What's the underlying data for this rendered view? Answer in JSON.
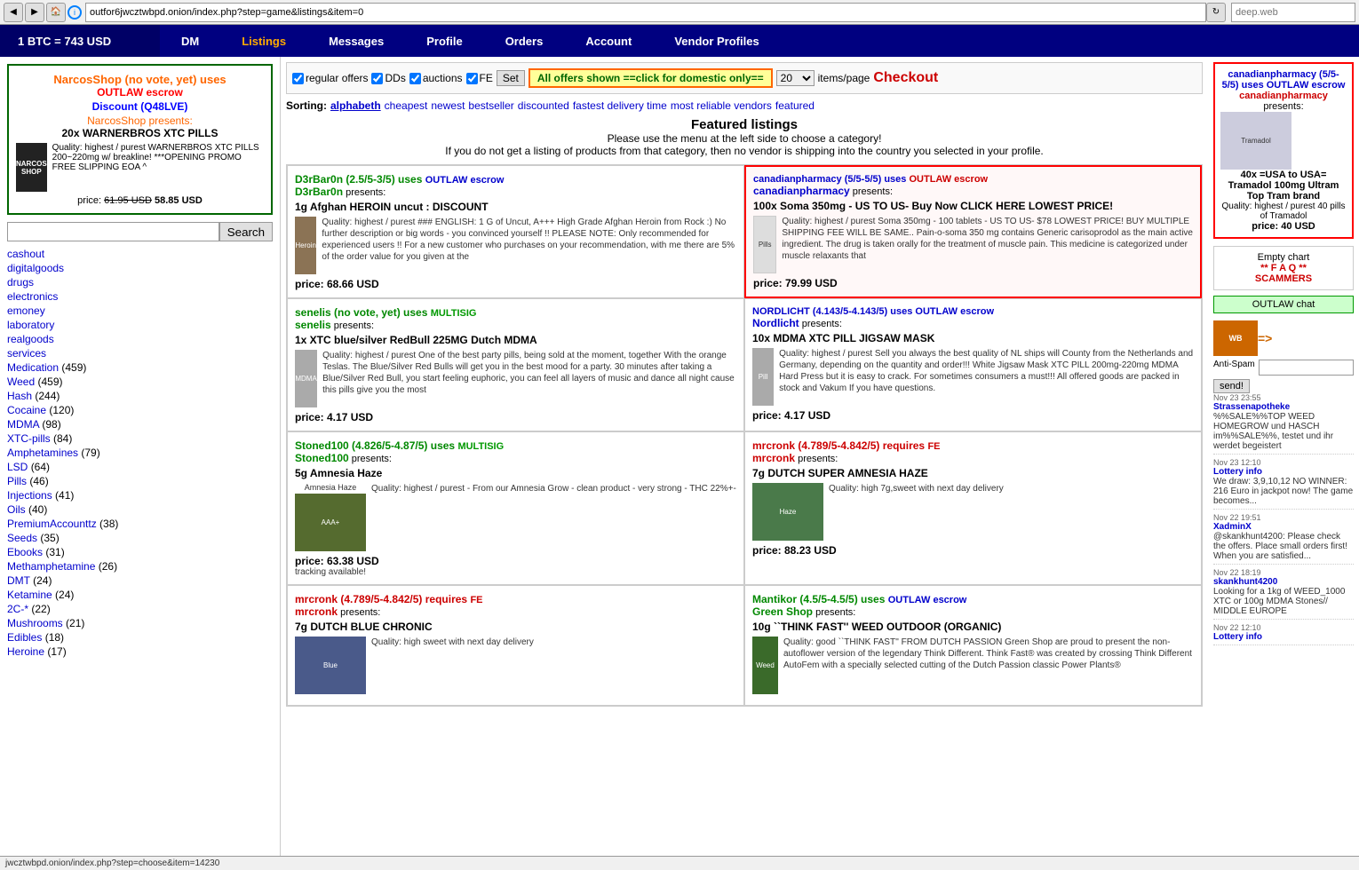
{
  "browser": {
    "url": "outfor6jwcztwbpd.onion/index.php?step=game&listings&item=0",
    "search_placeholder": "deep.web"
  },
  "nav": {
    "btc_rate": "1 BTC = 743 USD",
    "items": [
      {
        "label": "DM",
        "active": false
      },
      {
        "label": "Listings",
        "active": true
      },
      {
        "label": "Messages",
        "active": false
      },
      {
        "label": "Profile",
        "active": false
      },
      {
        "label": "Orders",
        "active": false
      },
      {
        "label": "Account",
        "active": false
      },
      {
        "label": "Vendor Profiles",
        "active": false
      }
    ]
  },
  "filters": {
    "regular_offers": "regular offers",
    "dds": "DDs",
    "auctions": "auctions",
    "fe": "FE",
    "set_btn": "Set",
    "domestic_btn": "All offers shown ==click for domestic only==",
    "items_per_page": "20",
    "checkout": "Checkout"
  },
  "sort": {
    "label": "Sorting:",
    "options": [
      "alphabeth",
      "cheapest",
      "newest",
      "bestseller",
      "discounted",
      "fastest delivery time",
      "most reliable vendors",
      "featured"
    ]
  },
  "featured_header": {
    "title": "Featured listings",
    "subtitle1": "Please use the menu at the left side to choose a category!",
    "subtitle2": "If you do not get a listing of products from that category, then no vendor is shipping into the country you selected in your profile."
  },
  "sidebar": {
    "featured_shop": {
      "name": "NarcosShop (no vote, yet) uses",
      "escrow": "OUTLAW escrow",
      "discount": "Discount (Q48LVE)",
      "presents": "NarcosShop presents:",
      "product": "20x WARNERBROS XTC PILLS",
      "quality": "Quality: highest / purest WARNERBROS XTC PILLS 200~220mg w/ breakline! ***OPENING PROMO FREE SLIPPING EOA ^",
      "price_old": "61.95 USD",
      "price_new": "58.85 USD"
    },
    "search_placeholder": "Search",
    "links": [
      {
        "label": "cashout",
        "count": ""
      },
      {
        "label": "digitalgoods",
        "count": ""
      },
      {
        "label": "drugs",
        "count": ""
      },
      {
        "label": "electronics",
        "count": ""
      },
      {
        "label": "emoney",
        "count": ""
      },
      {
        "label": "laboratory",
        "count": ""
      },
      {
        "label": "realgoods",
        "count": ""
      },
      {
        "label": "services",
        "count": ""
      },
      {
        "label": "Medication",
        "count": "(459)"
      },
      {
        "label": "Weed",
        "count": "(459)"
      },
      {
        "label": "Hash",
        "count": "(244)"
      },
      {
        "label": "Cocaine",
        "count": "(120)"
      },
      {
        "label": "MDMA",
        "count": "(98)"
      },
      {
        "label": "XTC-pills",
        "count": "(84)"
      },
      {
        "label": "Amphetamines",
        "count": "(79)"
      },
      {
        "label": "LSD",
        "count": "(64)"
      },
      {
        "label": "Pills",
        "count": "(46)"
      },
      {
        "label": "Injections",
        "count": "(41)"
      },
      {
        "label": "Oils",
        "count": "(40)"
      },
      {
        "label": "PremiumAccounttz",
        "count": "(38)"
      },
      {
        "label": "Seeds",
        "count": "(35)"
      },
      {
        "label": "Ebooks",
        "count": "(31)"
      },
      {
        "label": "Methamphetamine",
        "count": "(26)"
      },
      {
        "label": "DMT",
        "count": "(24)"
      },
      {
        "label": "Ketamine",
        "count": "(24)"
      },
      {
        "label": "2C-*",
        "count": "(22)"
      },
      {
        "label": "Mushrooms",
        "count": "(21)"
      },
      {
        "label": "Edibles",
        "count": "(18)"
      },
      {
        "label": "Heroine",
        "count": "(17)"
      }
    ]
  },
  "listings": [
    {
      "id": 1,
      "vendor_rating": "D3rBar0n (2.5/5-3/5) uses OUTLAW escrow",
      "vendor_name": "D3rBar0n",
      "vendor_color": "green",
      "escrow_type": "OUTLAW escrow",
      "badge": "escrow",
      "presents": "D3rBar0n presents:",
      "quantity": "1g",
      "product": "Afghan HEROIN uncut : DISCOUNT",
      "quality": "Quality: highest / purest ### ENGLISH: 1 G of Uncut, A+++ High Grade Afghan Heroin from Rock :) No further description or big words - you convinced yourself !! PLEASE NOTE: Only recommended for experienced users !! For a new customer who purchases on your recommendation, with me there are 5% of the order value for you given at the",
      "price": "68.66 USD",
      "highlighted": false,
      "img": "heroin"
    },
    {
      "id": 2,
      "vendor_rating": "canadianpharmacy (5/5-5/5) uses OUTLAW escrow",
      "vendor_name": "canadianpharmacy",
      "vendor_color": "blue",
      "escrow_type": "OUTLAW escrow",
      "badge": "escrow",
      "presents": "canadianpharmacy presents:",
      "quantity": "100x",
      "product": "Soma 350mg - US TO US- Buy Now CLICK HERE LOWEST PRICE!",
      "quality": "Quality: highest / purest Soma 350mg - 100 tablets - US TO US- $78 LOWEST PRICE! BUY MULTIPLE SHIPPING FEE WILL BE SAME.. Pain-o-soma 350 mg contains Generic carisoprodol as the main active ingredient. The drug is taken orally for the treatment of muscle pain. This medicine is categorized under muscle relaxants that",
      "price": "79.99 USD",
      "highlighted": true,
      "img": "soma"
    },
    {
      "id": 3,
      "vendor_rating": "senelis (no vote, yet) uses MULTISIG",
      "vendor_name": "senelis",
      "vendor_color": "green",
      "escrow_type": "MULTISIG",
      "badge": "multisig",
      "presents": "senelis presents:",
      "quantity": "1x",
      "product": "XTC blue/silver RedBull 225MG Dutch MDMA",
      "quality": "Quality: highest / purest One of the best party pills, being sold at the moment, together With the orange Teslas. The Blue/Silver Red Bulls will get you in the best mood for a party. 30 minutes after taking a Blue/Silver Red Bull, you start feeling euphoric, you can feel all layers of music and dance all night cause this pills give you the most",
      "price": "4.17 USD",
      "highlighted": false,
      "img": "mdma"
    },
    {
      "id": 4,
      "vendor_rating": "NORDLICHT (4.143/5-4.143/5) uses OUTLAW escrow",
      "vendor_name": "Nordlicht",
      "vendor_color": "blue",
      "escrow_type": "OUTLAW escrow",
      "badge": "escrow",
      "presents": "Nordlicht presents:",
      "quantity": "10x",
      "product": "MDMA XTC PILL JIGSAW MASK",
      "quality": "Quality: highest / purest Sell you always the best quality of NL ships will County from the Netherlands and Germany, depending on the quantity and order!!! White Jigsaw Mask XTC PILL 200mg-220mg MDMA Hard Press but it is easy to crack. For sometimes consumers a must!!! All offered goods are packed in stock and Vakum If you have questions.",
      "price": "price: 4.17 USD",
      "highlighted": false,
      "img": "mdma"
    },
    {
      "id": 5,
      "vendor_rating": "Stoned100 (4.826/5-4.87/5) uses MULTISIG",
      "vendor_name": "Stoned100",
      "vendor_color": "green",
      "escrow_type": "MULTISIG",
      "badge": "multisig",
      "presents": "Stoned100 presents:",
      "quantity": "5g",
      "product": "Amnesia Haze",
      "quality": "Quality: highest / purest - From our Amnesia Grow - clean product - very strong - THC 22%+-",
      "price": "63.38 USD",
      "tracking": "tracking available!",
      "highlighted": false,
      "img": "amnesia"
    },
    {
      "id": 6,
      "vendor_rating": "mrcronk (4.789/5-4.842/5) requires FE",
      "vendor_name": "mrcronk",
      "vendor_color": "red",
      "escrow_type": "FE",
      "badge": "fe",
      "presents": "mrcronk presents:",
      "quantity": "7g",
      "product": "DUTCH SUPER AMNESIA HAZE",
      "quality": "Quality: high 7g,sweet with next day delivery",
      "price": "88.23 USD",
      "highlighted": false,
      "img": "dutch"
    },
    {
      "id": 7,
      "vendor_rating": "mrcronk (4.789/5-4.842/5) requires FE",
      "vendor_name": "mrcronk",
      "vendor_color": "red",
      "escrow_type": "FE",
      "badge": "fe",
      "presents": "mrcronk presents:",
      "quantity": "7g",
      "product": "DUTCH BLUE CHRONIC",
      "quality": "Quality: high sweet with next day delivery",
      "price": "",
      "highlighted": false,
      "img": "blue"
    },
    {
      "id": 8,
      "vendor_rating": "Mantikor (4.5/5-4.5/5) uses OUTLAW escrow",
      "vendor_name": "Green Shop",
      "vendor_color": "green",
      "escrow_type": "OUTLAW escrow",
      "badge": "escrow",
      "presents": "Green Shop presents:",
      "quantity": "10g",
      "product": "``THINK FAST'' WEED OUTDOOR (ORGANIC)",
      "quality": "Quality: good ``THINK FAST'' FROM DUTCH PASSION Green Shop are proud to present the non-autoflower version of the legendary Think Different. Think Fast® was created by crossing Think Different AutoFem with a specially selected cutting of the Dutch Passion classic Power Plants®",
      "price": "",
      "highlighted": false,
      "img": "weed"
    }
  ],
  "right_sidebar": {
    "featured": {
      "vendor_rating": "canadianpharmacy (5/5-5/5) uses OUTLAW escrow",
      "vendor_name": "canadianpharmacy",
      "escrow": "OUTLAW escrow",
      "presents": "presents:",
      "product": "40x =USA to USA= Tramadol 100mg Ultram Top Tram brand",
      "quality": "Quality: highest / purest 40 pills of Tramadol",
      "price": "40 USD"
    },
    "empty_chart": "Empty chart",
    "faq": "** F A Q **",
    "scammers": "SCAMMERS",
    "outlaw_chat": "OUTLAW chat",
    "wb_label": "WB",
    "wb_arrow": "=>",
    "antispam_label": "Anti-Spam",
    "send_btn": "send!",
    "chat_messages": [
      {
        "time": "Nov 23 23:55",
        "user": "Strassenapotheke",
        "text": "%%SALE%%TOP WEED HOMEGROW und HASCH im%%SALE%%, testet und ihr werdet begeistert"
      },
      {
        "time": "Nov 23 12:10",
        "user": "Lottery info",
        "text": "We draw: 3,9,10,12 NO WINNER: 216 Euro in jackpot now! The game becomes..."
      },
      {
        "time": "Nov 22 19:51",
        "user": "XadminX",
        "text": "@skankhunt4200: Please check the offers. Place small orders first! When you are satisfied..."
      },
      {
        "time": "Nov 22 18:19",
        "user": "skankhunt4200",
        "text": "Looking for a 1kg of WEED_1000 XTC or 100g MDMA Stones// MIDDLE EUROPE"
      },
      {
        "time": "Nov 22 12:10",
        "user": "Lottery info",
        "text": ""
      }
    ]
  }
}
